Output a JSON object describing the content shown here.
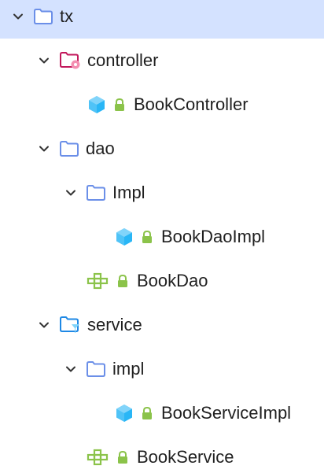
{
  "tree": {
    "root": {
      "label": "tx",
      "icon": "folder-icon",
      "expanded": true,
      "selected": true
    },
    "controller": {
      "label": "controller",
      "icon": "folder-config-icon",
      "expanded": true
    },
    "book_controller": {
      "label": "BookController",
      "icon": "class-icon",
      "access": "lock-icon"
    },
    "dao": {
      "label": "dao",
      "icon": "folder-icon",
      "expanded": true
    },
    "dao_impl": {
      "label": "Impl",
      "icon": "folder-icon",
      "expanded": true
    },
    "book_dao_impl": {
      "label": "BookDaoImpl",
      "icon": "class-icon",
      "access": "lock-icon"
    },
    "book_dao": {
      "label": "BookDao",
      "icon": "interface-icon",
      "access": "lock-icon"
    },
    "service": {
      "label": "service",
      "icon": "folder-service-icon",
      "expanded": true
    },
    "service_impl": {
      "label": "impl",
      "icon": "folder-icon",
      "expanded": true
    },
    "book_service_impl": {
      "label": "BookServiceImpl",
      "icon": "class-icon",
      "access": "lock-icon"
    },
    "book_service": {
      "label": "BookService",
      "icon": "interface-icon",
      "access": "lock-icon"
    }
  },
  "colors": {
    "selection": "#d4e2ff",
    "folder_outline": "#6b8fe8",
    "folder_config": "#c2185b",
    "folder_service": "#1e88e5",
    "class_icon": "#4fc3f7",
    "lock": "#8bc34a",
    "interface_icon": "#8bc34a"
  }
}
